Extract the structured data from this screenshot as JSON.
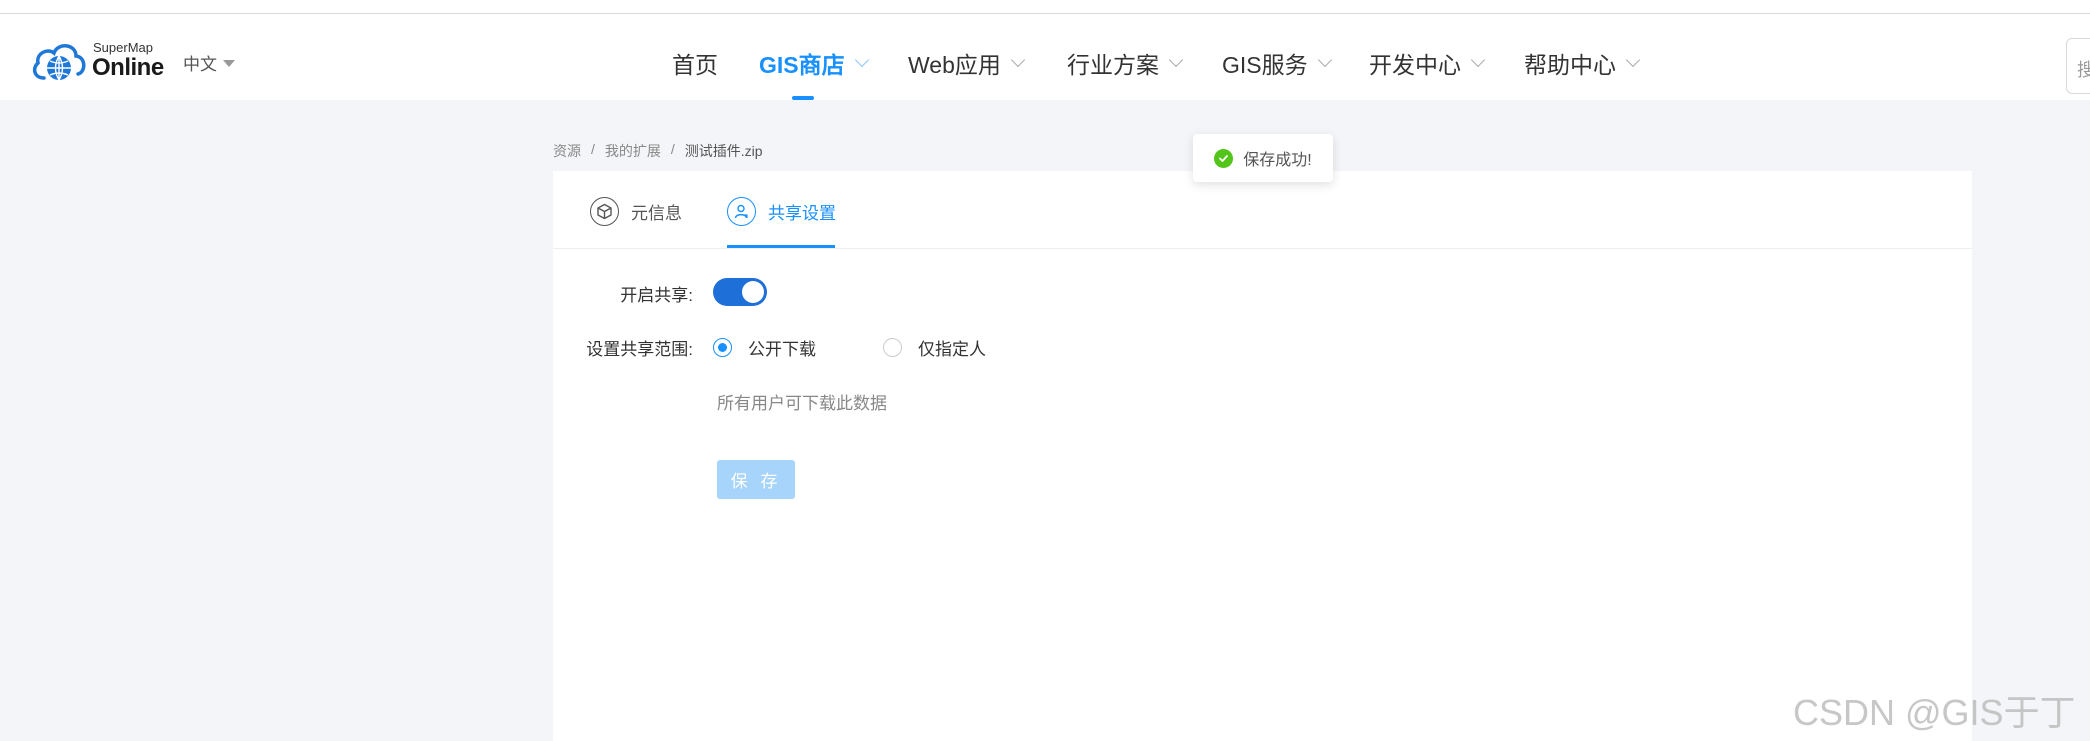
{
  "colors": {
    "accent": "#1890ff",
    "toggle_on": "#1e6fd8",
    "success": "#52c41a",
    "disabled_button": "#a6d4fa"
  },
  "header": {
    "logo": {
      "small": "SuperMap",
      "big": "Online"
    },
    "language": "中文",
    "nav": [
      {
        "label": "首页"
      },
      {
        "label": "GIS商店"
      },
      {
        "label": "Web应用"
      },
      {
        "label": "行业方案"
      },
      {
        "label": "GIS服务"
      },
      {
        "label": "开发中心"
      },
      {
        "label": "帮助中心"
      }
    ],
    "search_glyph": "搜"
  },
  "breadcrumb": {
    "items": [
      "资源",
      "我的扩展",
      "测试插件.zip"
    ],
    "separator": "/"
  },
  "toast": {
    "message": "保存成功!"
  },
  "tabs": [
    {
      "label": "元信息",
      "icon": "cube-icon"
    },
    {
      "label": "共享设置",
      "icon": "user-share-icon"
    }
  ],
  "form": {
    "share_label": "开启共享:",
    "share_enabled": true,
    "scope_label": "设置共享范围:",
    "scope_options": [
      {
        "label": "公开下载",
        "checked": true
      },
      {
        "label": "仅指定人",
        "checked": false
      }
    ],
    "hint": "所有用户可下载此数据",
    "save_label": "保 存"
  },
  "watermark": "CSDN @GIS于丁"
}
